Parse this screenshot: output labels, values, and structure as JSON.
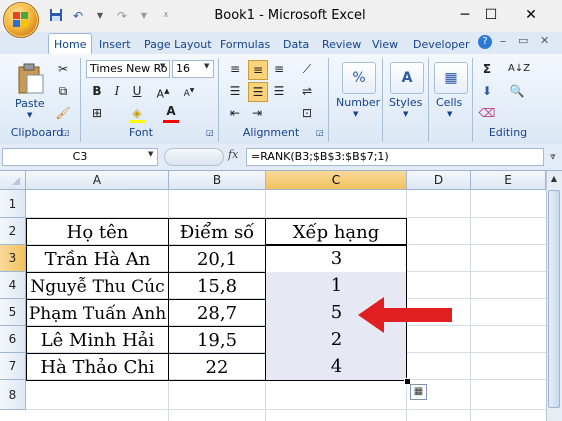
{
  "window": {
    "title": "Book1 - Microsoft Excel",
    "minimize": "─",
    "maximize": "☐",
    "close": "✕"
  },
  "tabs": [
    "Home",
    "Insert",
    "Page Layout",
    "Formulas",
    "Data",
    "Review",
    "View",
    "Developer"
  ],
  "ribbon": {
    "clipboard": {
      "label": "Clipboard",
      "paste": "Paste"
    },
    "font": {
      "label": "Font",
      "font_name": "Times New Ro",
      "font_size": "16"
    },
    "alignment": {
      "label": "Alignment"
    },
    "number": {
      "label": "Number",
      "icon_text": "%"
    },
    "styles": {
      "label": "Styles",
      "icon_text": "A"
    },
    "cells": {
      "label": "Cells"
    },
    "editing": {
      "label": "Editing"
    }
  },
  "formula_bar": {
    "name_box": "C3",
    "fx": "fx",
    "formula": "=RANK(B3;$B$3:$B$7;1)"
  },
  "grid": {
    "columns": [
      "A",
      "B",
      "C",
      "D",
      "E"
    ],
    "rows": [
      "1",
      "2",
      "3",
      "4",
      "5",
      "6",
      "7",
      "8"
    ],
    "selected_cell": "C3",
    "table": {
      "headers": [
        "Họ tên",
        "Điểm số",
        "Xếp hạng"
      ],
      "rows": [
        [
          "Trần Hà An",
          "20,1",
          "3"
        ],
        [
          "Nguyễ Thu Cúc",
          "15,8",
          "1"
        ],
        [
          "Phạm Tuấn Anh",
          "28,7",
          "5"
        ],
        [
          "Lê Minh Hải",
          "19,5",
          "2"
        ],
        [
          "Hà Thảo Chi",
          "22",
          "4"
        ]
      ]
    }
  },
  "colors": {
    "accent_arrow": "#e02020",
    "selection_fill": "#e6e8f3",
    "header_selected": "#f1c15f"
  }
}
